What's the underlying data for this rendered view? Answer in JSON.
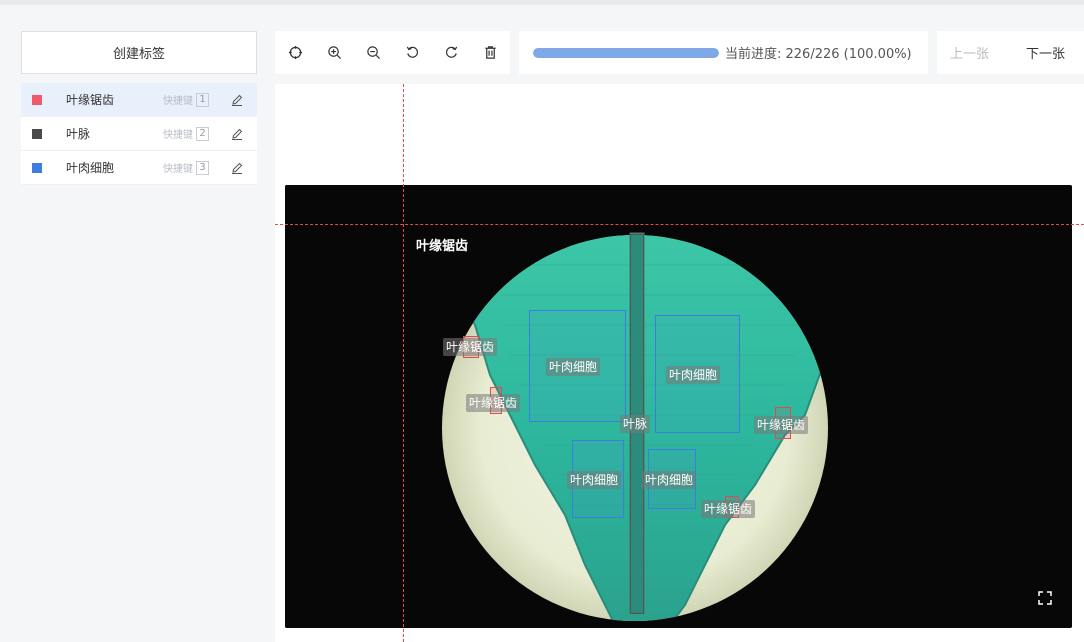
{
  "sidebar": {
    "create_label": "创建标签",
    "items": [
      {
        "name": "叶缘锯齿",
        "color": "#f05a6a",
        "shortcut_label": "快捷键",
        "key": "1"
      },
      {
        "name": "叶脉",
        "color": "#4a4a4a",
        "shortcut_label": "快捷键",
        "key": "2"
      },
      {
        "name": "叶肉细胞",
        "color": "#3d7de0",
        "shortcut_label": "快捷键",
        "key": "3"
      }
    ]
  },
  "toolbar": {
    "tools": [
      "crosshair-icon",
      "zoom-in-icon",
      "zoom-out-icon",
      "rotate-left-icon",
      "rotate-right-icon",
      "delete-icon"
    ]
  },
  "progress": {
    "value": 1.0,
    "text": "当前进度: 226/226 (100.00%)"
  },
  "nav": {
    "prev": "上一张",
    "next": "下一张"
  },
  "canvas": {
    "cursor_label": "叶缘锯齿",
    "annotations": [
      {
        "label": "叶缘锯齿"
      },
      {
        "label": "叶缘锯齿"
      },
      {
        "label": "叶肉细胞"
      },
      {
        "label": "叶肉细胞"
      },
      {
        "label": "叶脉"
      },
      {
        "label": "叶缘锯齿"
      },
      {
        "label": "叶肉细胞"
      },
      {
        "label": "叶肉细胞"
      },
      {
        "label": "叶缘锯齿"
      }
    ]
  }
}
